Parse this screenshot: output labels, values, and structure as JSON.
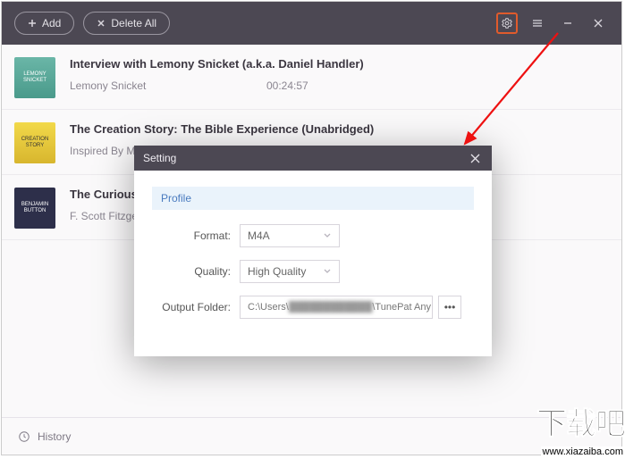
{
  "titlebar": {
    "add_label": "Add",
    "delete_all_label": "Delete All"
  },
  "rows": [
    {
      "title": "Interview with Lemony Snicket (a.k.a. Daniel Handler)",
      "author": "Lemony Snicket",
      "duration": "00:24:57",
      "thumb_text": "LEMONY SNICKET"
    },
    {
      "title": "The Creation Story: The Bible Experience (Unabridged)",
      "author": "Inspired By Me",
      "duration": "",
      "thumb_text": "CREATION STORY"
    },
    {
      "title": "The Curious",
      "author": "F. Scott Fitzgera",
      "duration": "",
      "thumb_text": "BENJAMIN BUTTON"
    }
  ],
  "footer": {
    "history_label": "History"
  },
  "modal": {
    "title": "Setting",
    "section": "Profile",
    "format_label": "Format:",
    "format_value": "M4A",
    "quality_label": "Quality:",
    "quality_value": "High Quality",
    "output_label": "Output Folder:",
    "output_prefix": "C:\\Users\\",
    "output_blurred": "████████████",
    "output_suffix": "\\TunePat Any Aud",
    "more_label": "•••"
  },
  "watermark": {
    "big": "下载吧",
    "url": "www.xiazaiba.com"
  }
}
